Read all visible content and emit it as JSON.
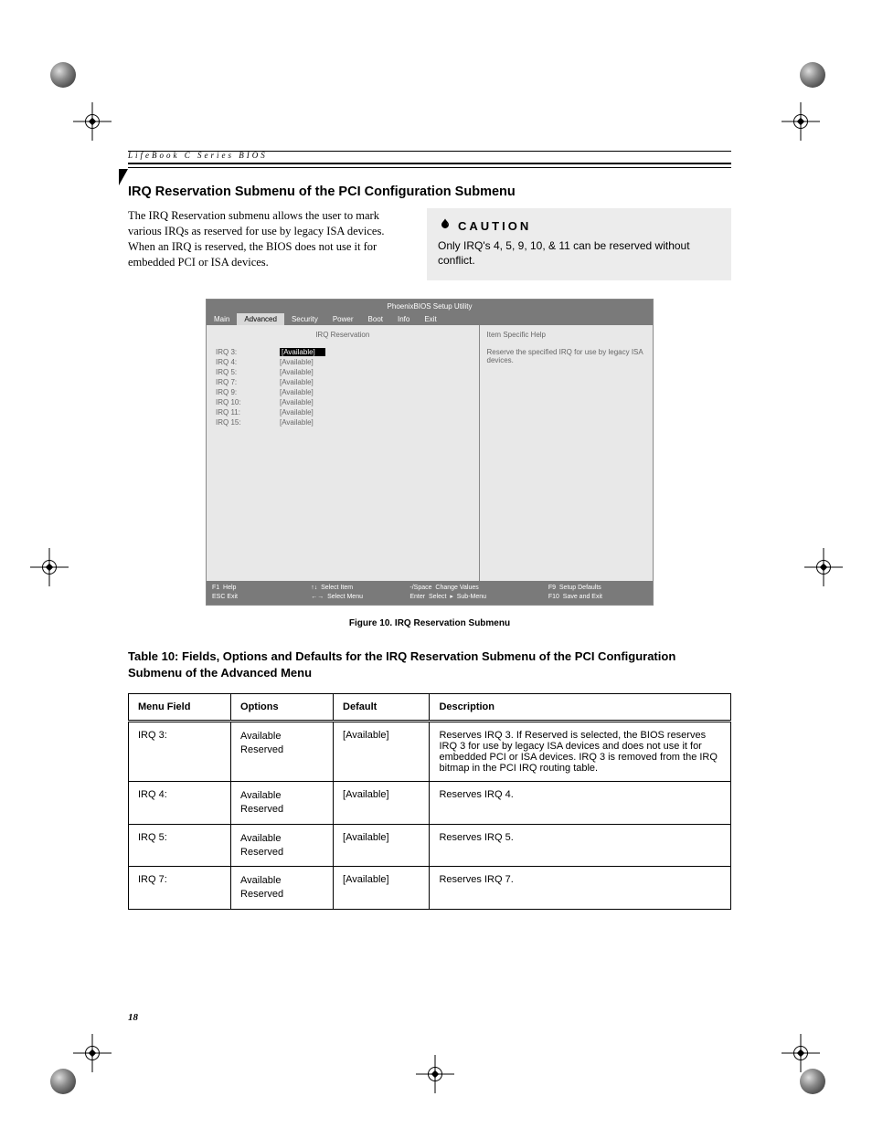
{
  "runningHead": "LifeBook C Series BIOS",
  "sectionTitle": "IRQ Reservation Submenu of the PCI Configuration Submenu",
  "introText": "The IRQ Reservation submenu allows the user to mark various IRQs as reserved for use by legacy ISA devices. When an IRQ is reserved, the BIOS does not use it for embedded PCI or ISA devices.",
  "caution": {
    "label": "CAUTION",
    "text": "Only IRQ's 4, 5, 9, 10, & 11 can be reserved without conflict."
  },
  "bios": {
    "title": "PhoenixBIOS Setup Utility",
    "tabs": [
      "Main",
      "Advanced",
      "Security",
      "Power",
      "Boot",
      "Info",
      "Exit"
    ],
    "activeTab": "Advanced",
    "subtitle": "IRQ Reservation",
    "helpTitle": "Item Specific Help",
    "helpText": "Reserve the specified IRQ for use by legacy ISA devices.",
    "rows": [
      {
        "label": "IRQ 3:",
        "value": "[Available]",
        "selected": true
      },
      {
        "label": "IRQ 4:",
        "value": "[Available]"
      },
      {
        "label": "IRQ 5:",
        "value": "[Available]"
      },
      {
        "label": "IRQ 7:",
        "value": "[Available]"
      },
      {
        "label": "IRQ 9:",
        "value": "[Available]"
      },
      {
        "label": "IRQ 10:",
        "value": "[Available]"
      },
      {
        "label": "IRQ 11:",
        "value": "[Available]"
      },
      {
        "label": "IRQ 15:",
        "value": "[Available]"
      }
    ],
    "footer": {
      "c1": "F1  Help\nESC Exit",
      "c2": "↑↓  Select Item\n←→  Select Menu",
      "c3": "-/Space  Change Values\nEnter  Select  ▸  Sub-Menu",
      "c4": "F9  Setup Defaults\nF10  Save and Exit"
    }
  },
  "figureCaption": "Figure 10.   IRQ Reservation Submenu",
  "tableCaption": "Table 10: Fields, Options and Defaults for the IRQ Reservation Submenu of the PCI Configuration Submenu of the Advanced Menu",
  "table": {
    "headers": [
      "Menu Field",
      "Options",
      "Default",
      "Description"
    ],
    "rows": [
      {
        "field": "IRQ 3:",
        "opt1": "Available",
        "opt2": "Reserved",
        "def": "[Available]",
        "desc": "Reserves IRQ 3. If Reserved is selected, the BIOS reserves IRQ 3 for use by legacy ISA devices and does not use it for embedded PCI or ISA devices. IRQ 3 is removed from the IRQ bitmap in the PCI IRQ routing table."
      },
      {
        "field": "IRQ 4:",
        "opt1": "Available",
        "opt2": "Reserved",
        "def": "[Available]",
        "desc": "Reserves IRQ 4."
      },
      {
        "field": "IRQ 5:",
        "opt1": "Available",
        "opt2": "Reserved",
        "def": "[Available]",
        "desc": "Reserves IRQ 5."
      },
      {
        "field": "IRQ 7:",
        "opt1": "Available",
        "opt2": "Reserved",
        "def": "[Available]",
        "desc": "Reserves IRQ 7."
      }
    ]
  },
  "pageNumber": "18"
}
